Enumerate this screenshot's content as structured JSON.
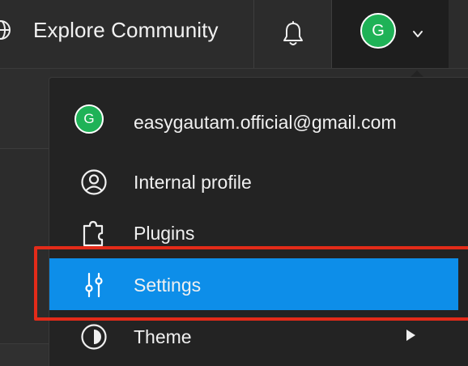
{
  "nav": {
    "title": "Explore Community",
    "globe_icon": "globe-icon",
    "bell_icon": "bell-icon",
    "chevron_icon": "chevron-down-icon"
  },
  "account": {
    "avatar_initial": "G",
    "avatar_color": "#1fb257"
  },
  "menu": {
    "email": "easygautam.official@gmail.com",
    "items": [
      {
        "label": "Internal profile",
        "icon": "user-circle-icon"
      },
      {
        "label": "Plugins",
        "icon": "puzzle-icon"
      },
      {
        "label": "Settings",
        "icon": "sliders-icon",
        "selected": true
      },
      {
        "label": "Theme",
        "icon": "contrast-icon",
        "has_submenu": true
      }
    ]
  },
  "colors": {
    "highlight": "#0d8ee9",
    "annotation_box": "#e32b19"
  }
}
